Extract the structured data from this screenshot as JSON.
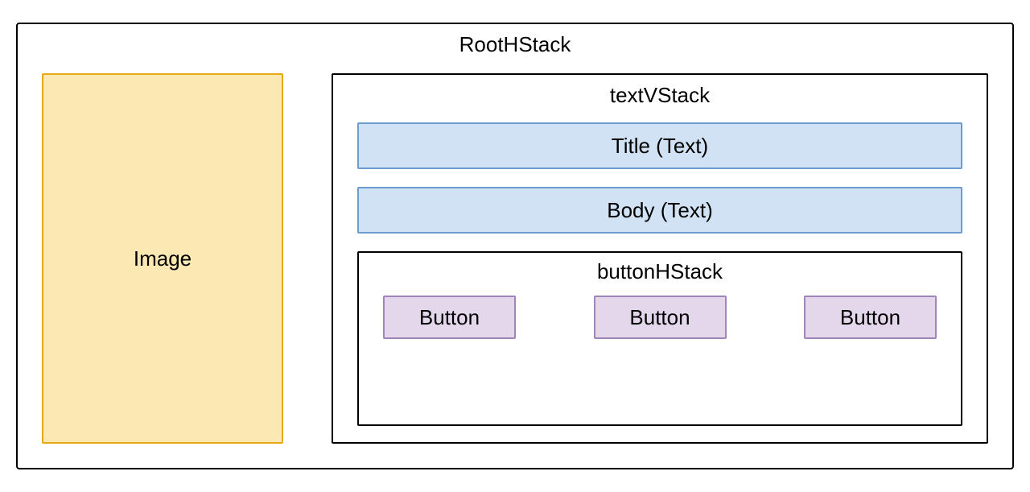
{
  "root": {
    "label": "RootHStack",
    "image_label": "Image"
  },
  "textVStack": {
    "label": "textVStack",
    "title_label": "Title (Text)",
    "body_label": "Body (Text)"
  },
  "buttonHStack": {
    "label": "buttonHStack",
    "buttons": [
      "Button",
      "Button",
      "Button"
    ]
  },
  "colors": {
    "image_fill": "#fce8b2",
    "image_border": "#e6a817",
    "text_fill": "#d0e2f3",
    "text_border": "#6b9bd1",
    "button_fill": "#e4d7ec",
    "button_border": "#a284bd"
  }
}
